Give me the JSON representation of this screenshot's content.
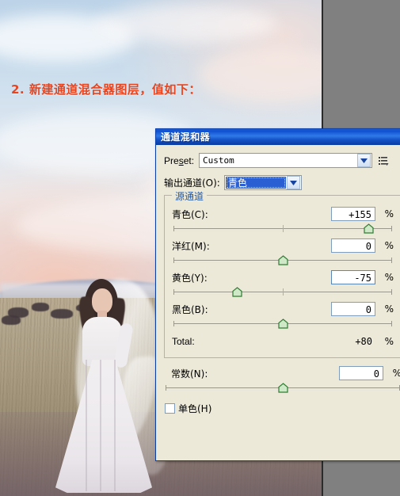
{
  "canvas": {
    "background_color": "#808080",
    "instruction_text": "2. 新建通道混合器图层，值如下：",
    "instruction_color": "#e8441f",
    "photo_alt": "bride-in-grassland-photo"
  },
  "dialog": {
    "title": "通道混和器",
    "titlebar_color": "#0f4fd0",
    "background_color": "#ece9d8",
    "preset": {
      "label": "Preset:",
      "value": "Custom",
      "menu_icon": "list-menu-icon",
      "dropdown_icon": "chevron-down-icon"
    },
    "output_channel": {
      "label": "输出通道(O):",
      "value": "青色",
      "selected": true,
      "highlight_color": "#2a5fd4",
      "dropdown_icon": "chevron-down-icon"
    },
    "source_channels": {
      "group_label": "源通道",
      "group_label_color": "#2159a8",
      "sliders": [
        {
          "label": "青色(C):",
          "value": "+155",
          "unit": "%",
          "percent": 89,
          "focused": false
        },
        {
          "label": "洋红(M):",
          "value": "0",
          "unit": "%",
          "percent": 50,
          "focused": false
        },
        {
          "label": "黄色(Y):",
          "value": "-75",
          "unit": "%",
          "percent": 29,
          "focused": true
        },
        {
          "label": "黑色(B):",
          "value": "0",
          "unit": "%",
          "percent": 50,
          "focused": false
        }
      ],
      "total": {
        "label": "Total:",
        "value": "+80",
        "unit": "%"
      }
    },
    "constant": {
      "label": "常数(N):",
      "value": "0",
      "unit": "%",
      "percent": 50
    },
    "monochrome": {
      "label": "单色(H)",
      "checked": false
    }
  }
}
